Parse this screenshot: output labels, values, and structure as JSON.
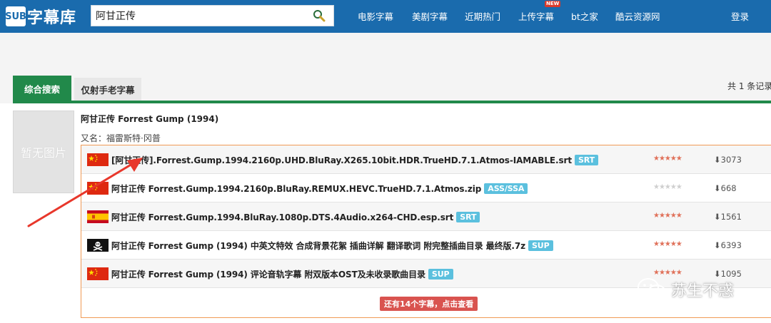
{
  "header": {
    "logo_mark": "SUB",
    "logo_text": "字幕库",
    "search_value": "阿甘正传",
    "nav": [
      "电影字幕",
      "美剧字幕",
      "近期热门",
      "上传字幕",
      "bt之家",
      "酷云资源网",
      "登录"
    ],
    "new_badge": "NEW"
  },
  "tabs": {
    "active": "综合搜索",
    "inactive": "仅射手老字幕",
    "count": "共 1 条记录"
  },
  "movie": {
    "poster_text": "暂无图片",
    "title": "阿甘正传 Forrest Gump (1994)",
    "alias": "又名：福雷斯特·冈普"
  },
  "subtitles": [
    {
      "flag": "cn",
      "name": "[阿甘正传].Forrest.Gump.1994.2160p.UHD.BluRay.X265.10bit.HDR.TrueHD.7.1.Atmos-IAMABLE.srt",
      "format": "SRT",
      "stars": "★★★★★",
      "rated": true,
      "downloads": "3073"
    },
    {
      "flag": "cn",
      "name": "阿甘正传 Forrest.Gump.1994.2160p.BluRay.REMUX.HEVC.TrueHD.7.1.Atmos.zip",
      "format": "ASS/SSA",
      "stars": "★★★★★",
      "rated": false,
      "downloads": "668"
    },
    {
      "flag": "es",
      "name": "阿甘正传 Forrest.Gump.1994.BluRay.1080p.DTS.4Audio.x264-CHD.esp.srt",
      "format": "SRT",
      "stars": "★★★★★",
      "rated": true,
      "downloads": "1561"
    },
    {
      "flag": "pirate",
      "name": "阿甘正传 Forrest Gump (1994) 中英文特效 合成背景花絮 插曲详解 翻译歌词 附完整插曲目录 最终版.7z",
      "format": "SUP",
      "stars": "★★★★★",
      "rated": true,
      "downloads": "6393"
    },
    {
      "flag": "cn",
      "name": "阿甘正传 Forrest Gump (1994) 评论音轨字幕 附双版本OST及未收录歌曲目录",
      "format": "SUP",
      "stars": "★★★★★",
      "rated": true,
      "downloads": "1095"
    }
  ],
  "more_button": "还有14个字幕，点击查看",
  "watermark": "苏生不惑",
  "colors": {
    "header": "#1a6bad",
    "tab_active": "#21894a",
    "list_border": "#f09a55",
    "badge": "#5bc0de",
    "more": "#d9534f",
    "arrow": "#e8372b"
  }
}
